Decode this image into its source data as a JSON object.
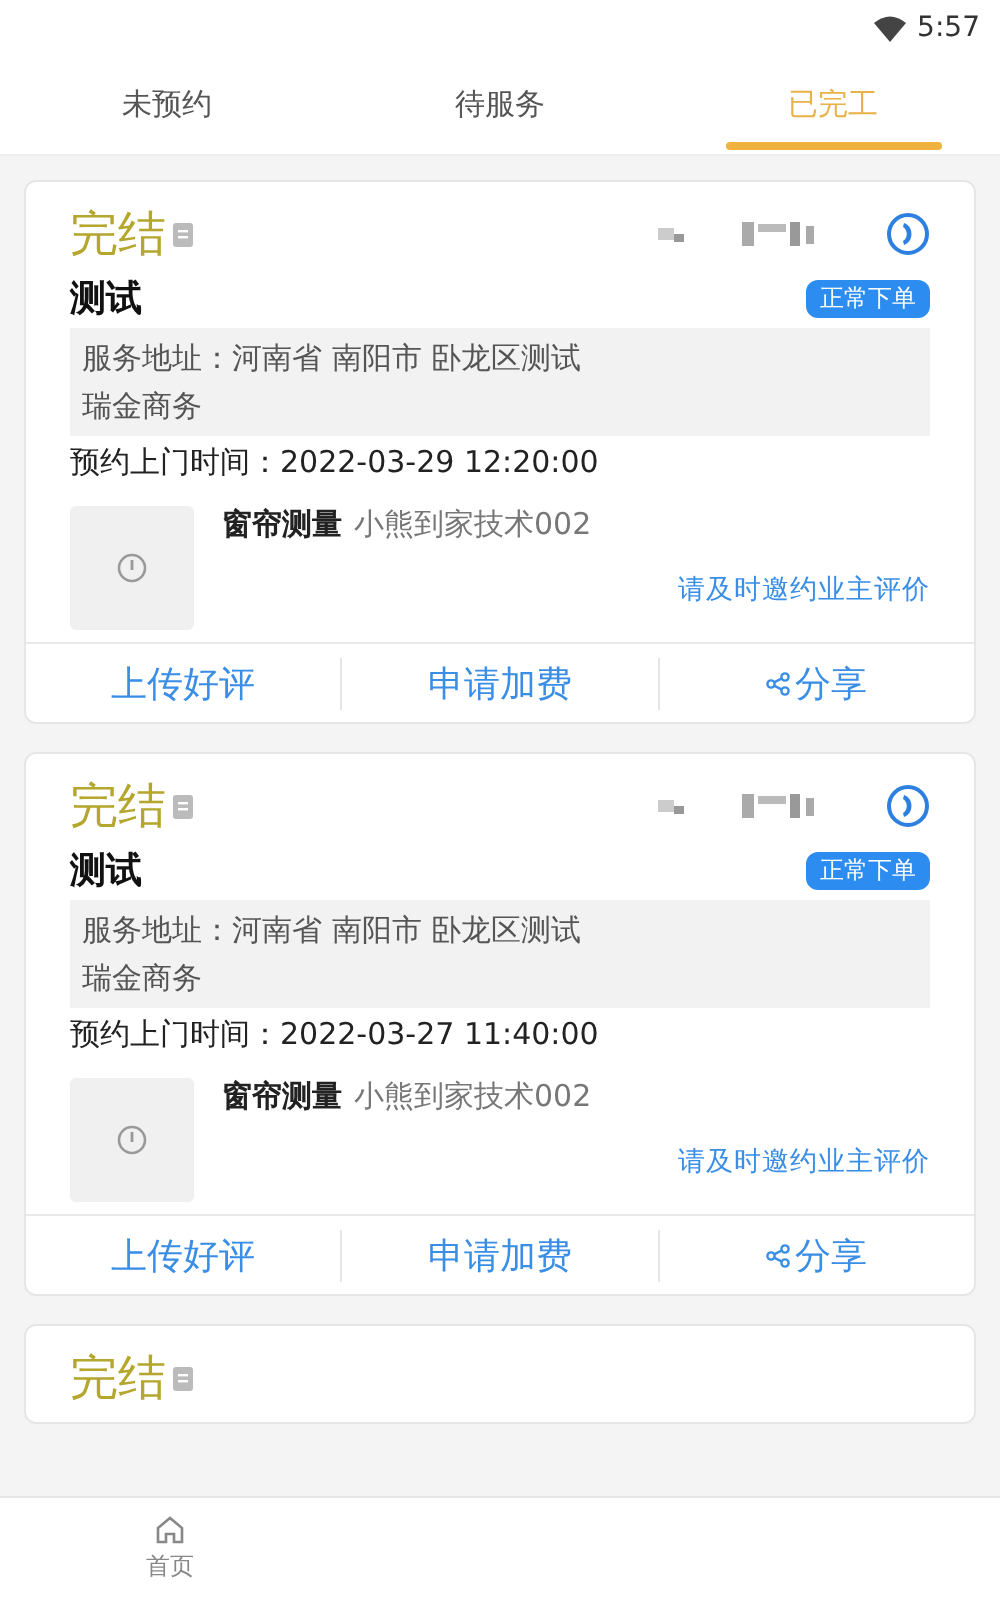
{
  "status_bar": {
    "time": "5:57"
  },
  "tabs": [
    {
      "label": "未预约",
      "selected": false
    },
    {
      "label": "待服务",
      "selected": false
    },
    {
      "label": "已完工",
      "selected": true
    }
  ],
  "orders": [
    {
      "status": "完结",
      "title": "测试",
      "badge": "正常下单",
      "address_lines": [
        "服务地址：河南省 南阳市 卧龙区测试",
        "瑞金商务"
      ],
      "time": "预约上门时间：2022-03-29 12:20:00",
      "product": "窗帘测量",
      "technician": "小熊到家技术002",
      "hint": "请及时邀约业主评价",
      "actions": [
        {
          "label": "上传好评",
          "kind": "plain"
        },
        {
          "label": "申请加费",
          "kind": "plain"
        },
        {
          "label": "分享",
          "kind": "share"
        }
      ]
    },
    {
      "status": "完结",
      "title": "测试",
      "badge": "正常下单",
      "address_lines": [
        "服务地址：河南省 南阳市 卧龙区测试",
        "瑞金商务"
      ],
      "time": "预约上门时间：2022-03-27 11:40:00",
      "product": "窗帘测量",
      "technician": "小熊到家技术002",
      "hint": "请及时邀约业主评价",
      "actions": [
        {
          "label": "上传好评",
          "kind": "plain"
        },
        {
          "label": "申请加费",
          "kind": "plain"
        },
        {
          "label": "分享",
          "kind": "share"
        }
      ]
    },
    {
      "status": "完结"
    }
  ],
  "bottom_nav": [
    {
      "label": "首页",
      "selected": false
    }
  ]
}
